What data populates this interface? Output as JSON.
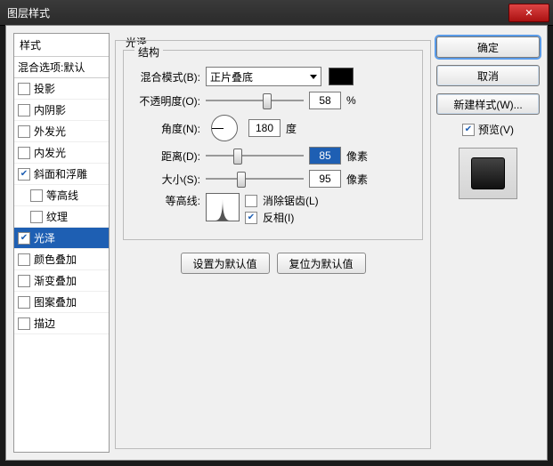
{
  "window": {
    "title": "图层样式"
  },
  "styles": {
    "header": "样式",
    "blend_defaults": "混合选项:默认",
    "items": [
      {
        "label": "投影",
        "checked": false
      },
      {
        "label": "内阴影",
        "checked": false
      },
      {
        "label": "外发光",
        "checked": false
      },
      {
        "label": "内发光",
        "checked": false
      },
      {
        "label": "斜面和浮雕",
        "checked": true
      },
      {
        "label": "等高线",
        "checked": false,
        "sub": true
      },
      {
        "label": "纹理",
        "checked": false,
        "sub": true
      },
      {
        "label": "光泽",
        "checked": true,
        "selected": true
      },
      {
        "label": "颜色叠加",
        "checked": false
      },
      {
        "label": "渐变叠加",
        "checked": false
      },
      {
        "label": "图案叠加",
        "checked": false
      },
      {
        "label": "描边",
        "checked": false
      }
    ]
  },
  "satin": {
    "section_title": "光泽",
    "group_title": "结构",
    "blend_mode_label": "混合模式(B):",
    "blend_mode_value": "正片叠底",
    "opacity_label": "不透明度(O):",
    "opacity_value": "58",
    "opacity_unit": "%",
    "angle_label": "角度(N):",
    "angle_value": "180",
    "angle_unit": "度",
    "distance_label": "距离(D):",
    "distance_value": "85",
    "distance_unit": "像素",
    "size_label": "大小(S):",
    "size_value": "95",
    "size_unit": "像素",
    "contour_label": "等高线:",
    "antialias_label": "消除锯齿(L)",
    "antialias_checked": false,
    "invert_label": "反相(I)",
    "invert_checked": true,
    "reset_default": "设置为默认值",
    "restore_default": "复位为默认值"
  },
  "right": {
    "ok": "确定",
    "cancel": "取消",
    "new_style": "新建样式(W)...",
    "preview_label": "预览(V)",
    "preview_checked": true
  }
}
